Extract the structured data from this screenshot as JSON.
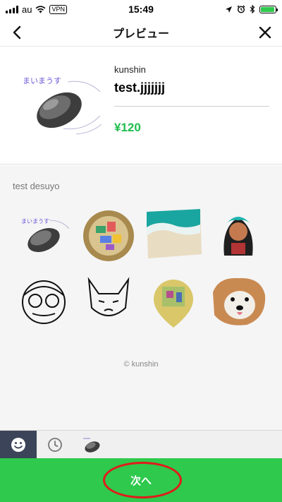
{
  "status_bar": {
    "carrier": "au",
    "vpn": "VPN",
    "time": "15:49",
    "battery_level": 0.95,
    "icons": [
      "signal-icon",
      "wifi-icon",
      "vpn-badge",
      "location-icon",
      "alarm-icon",
      "bluetooth-icon",
      "battery-icon"
    ]
  },
  "nav": {
    "title": "プレビュー",
    "back_icon": "chevron-left-icon",
    "close_icon": "close-icon"
  },
  "product": {
    "creator": "kunshin",
    "title": "test.jjjjjjj",
    "price": "¥120",
    "image_caption": "まいまうす",
    "price_color": "#1fbd4d"
  },
  "preview": {
    "description": "test desuyo",
    "stickers": [
      {
        "name": "mouse-sticker",
        "caption": "まいまうす"
      },
      {
        "name": "snack-basket-sticker"
      },
      {
        "name": "beach-sticker"
      },
      {
        "name": "anime-girl-sticker"
      },
      {
        "name": "face-doodle-sticker"
      },
      {
        "name": "cat-doodle-sticker"
      },
      {
        "name": "room-map-sticker"
      },
      {
        "name": "dog-photo-sticker"
      }
    ],
    "copyright": "© kunshin"
  },
  "tabs": [
    {
      "name": "emoji-tab",
      "icon": "smiley-icon",
      "active": true
    },
    {
      "name": "recent-tab",
      "icon": "clock-icon",
      "active": false
    },
    {
      "name": "sticker-tab",
      "icon": "mouse-thumbnail",
      "active": false
    }
  ],
  "next_button": {
    "label": "次へ",
    "color": "#2ec94d",
    "annotation_color": "#e01b1b"
  }
}
